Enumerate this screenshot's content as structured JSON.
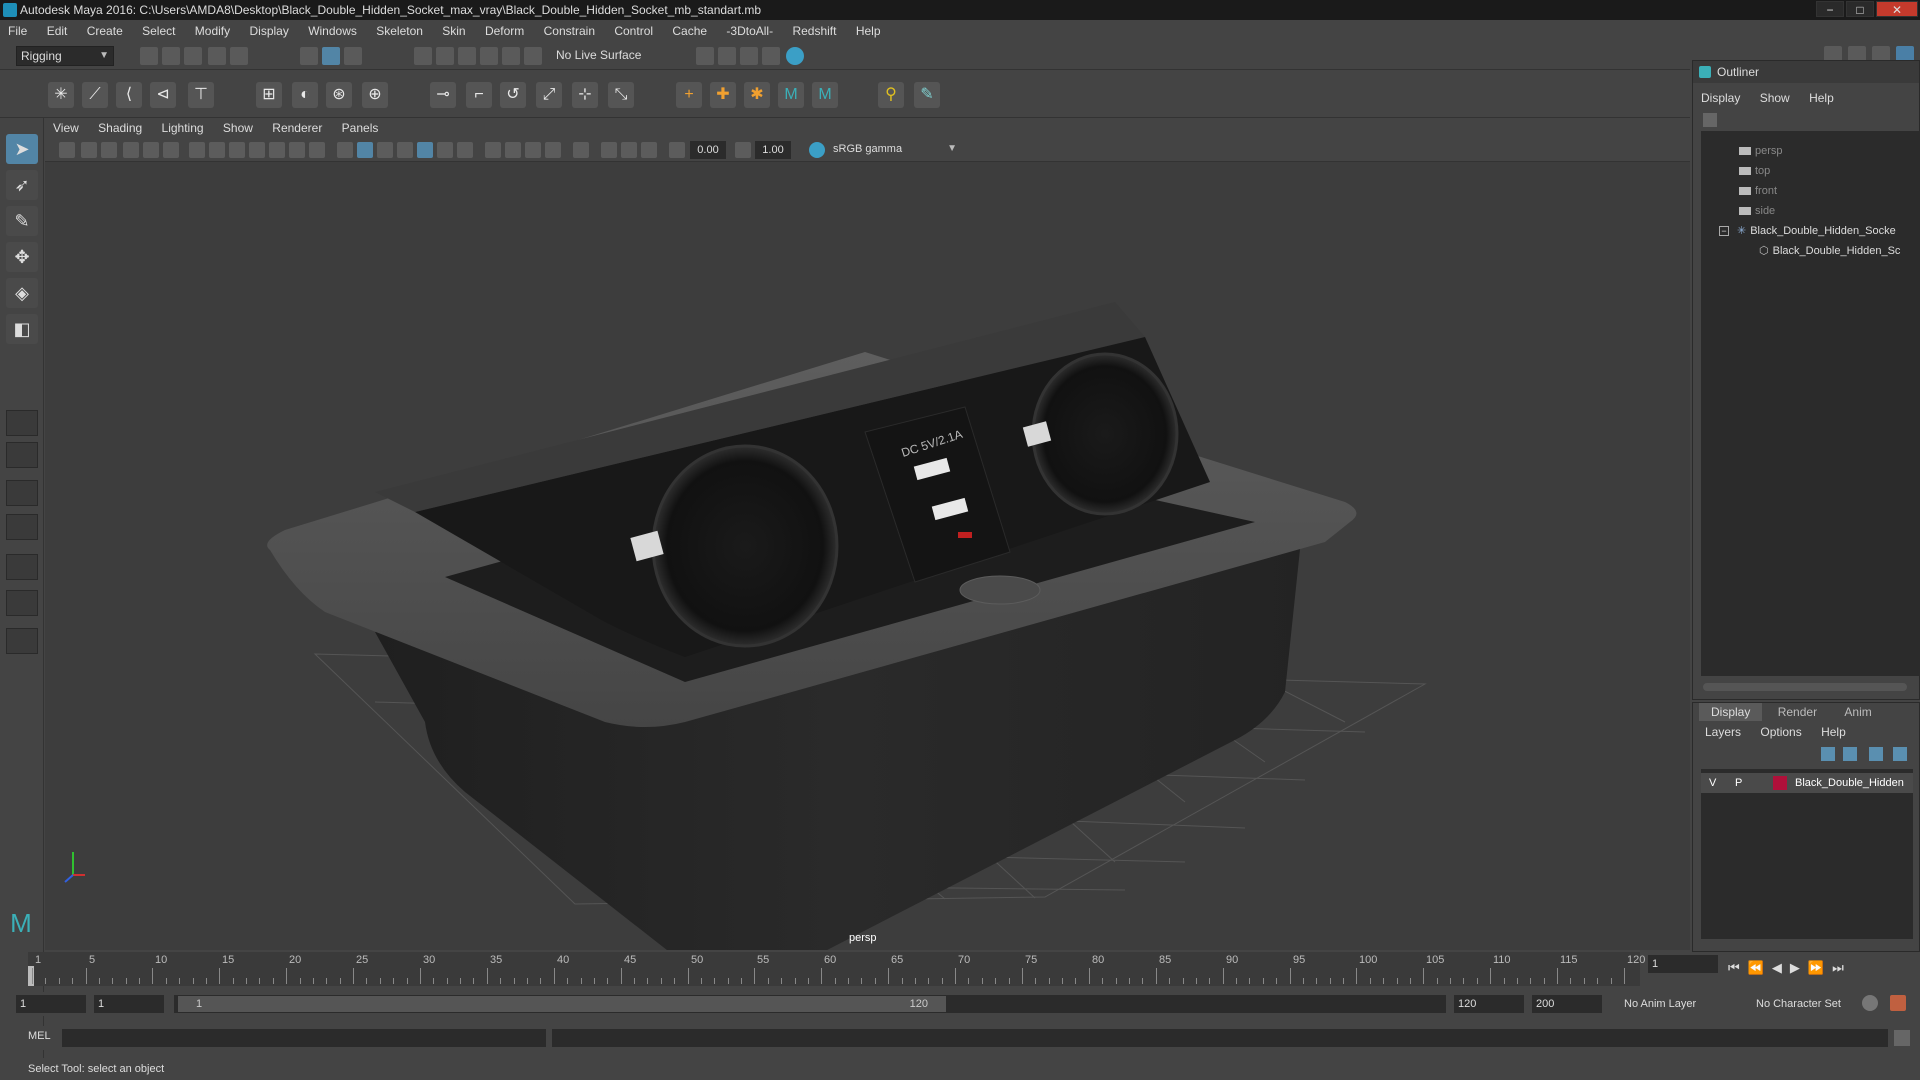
{
  "window": {
    "title": "Autodesk Maya 2016: C:\\Users\\AMDA8\\Desktop\\Black_Double_Hidden_Socket_max_vray\\Black_Double_Hidden_Socket_mb_standart.mb",
    "minimize": "−",
    "maximize": "□",
    "close": "✕"
  },
  "menubar": [
    "File",
    "Edit",
    "Create",
    "Select",
    "Modify",
    "Display",
    "Windows",
    "Skeleton",
    "Skin",
    "Deform",
    "Constrain",
    "Control",
    "Cache",
    "-3DtoAll-",
    "Redshift",
    "Help"
  ],
  "statusline": {
    "menuset": "Rigging",
    "live_surface": "No Live Surface"
  },
  "viewport": {
    "menu": [
      "View",
      "Shading",
      "Lighting",
      "Show",
      "Renderer",
      "Panels"
    ],
    "exposure": "0.00",
    "gamma": "1.00",
    "color_space": "sRGB gamma",
    "camera_label": "persp",
    "socket_label": "DC 5V/2.1A"
  },
  "outliner": {
    "title": "Outliner",
    "menu": [
      "Display",
      "Show",
      "Help"
    ],
    "items": [
      {
        "label": "persp",
        "kind": "camera"
      },
      {
        "label": "top",
        "kind": "camera"
      },
      {
        "label": "front",
        "kind": "camera"
      },
      {
        "label": "side",
        "kind": "camera"
      },
      {
        "label": "Black_Double_Hidden_Socke",
        "kind": "group"
      },
      {
        "label": "Black_Double_Hidden_Sc",
        "kind": "mesh"
      }
    ]
  },
  "layer_editor": {
    "tabs": [
      "Display",
      "Render",
      "Anim"
    ],
    "menu": [
      "Layers",
      "Options",
      "Help"
    ],
    "layer": {
      "visible": "V",
      "playback": "P",
      "name": "Black_Double_Hidden",
      "color": "#b0103a"
    }
  },
  "timeline": {
    "labels": [
      "1",
      "5",
      "10",
      "15",
      "20",
      "25",
      "30",
      "35",
      "40",
      "45",
      "50",
      "55",
      "60",
      "65",
      "70",
      "75",
      "80",
      "85",
      "90",
      "95",
      "100",
      "105",
      "110",
      "115",
      "120"
    ],
    "current_frame": "1"
  },
  "range": {
    "start": "1",
    "playback_start": "1",
    "slider_start": "1",
    "slider_end": "120",
    "playback_end": "120",
    "end": "200",
    "anim_layer": "No Anim Layer",
    "character_set": "No Character Set"
  },
  "command": {
    "language": "MEL"
  },
  "helpline": "Select Tool: select an object",
  "icons": {
    "toolbox": [
      "select-arrow-icon",
      "lasso-icon",
      "paint-select-icon",
      "move-icon",
      "rotate-icon",
      "scale-icon"
    ]
  }
}
